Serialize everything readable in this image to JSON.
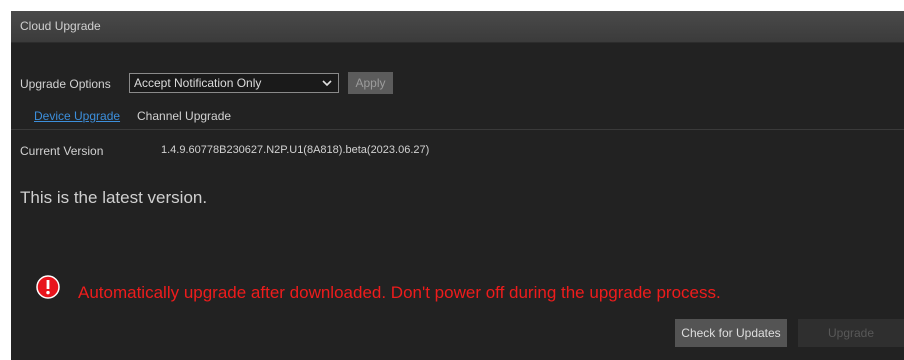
{
  "window": {
    "title": "Cloud Upgrade"
  },
  "options": {
    "label": "Upgrade Options",
    "selected": "Accept Notification Only",
    "apply_label": "Apply"
  },
  "tabs": {
    "device": "Device Upgrade",
    "channel": "Channel Upgrade"
  },
  "version": {
    "label": "Current Version",
    "value": "1.4.9.60778B230627.N2P.U1(8A818).beta(2023.06.27)"
  },
  "status": {
    "message": "This is the latest version."
  },
  "warning": {
    "icon": "info-icon",
    "text": "Automatically upgrade after downloaded. Don't power off during the upgrade process.",
    "color": "#ee1c1c"
  },
  "actions": {
    "check_label": "Check for Updates",
    "upgrade_label": "Upgrade"
  },
  "colors": {
    "background": "#222222",
    "link": "#3c8fdc"
  }
}
